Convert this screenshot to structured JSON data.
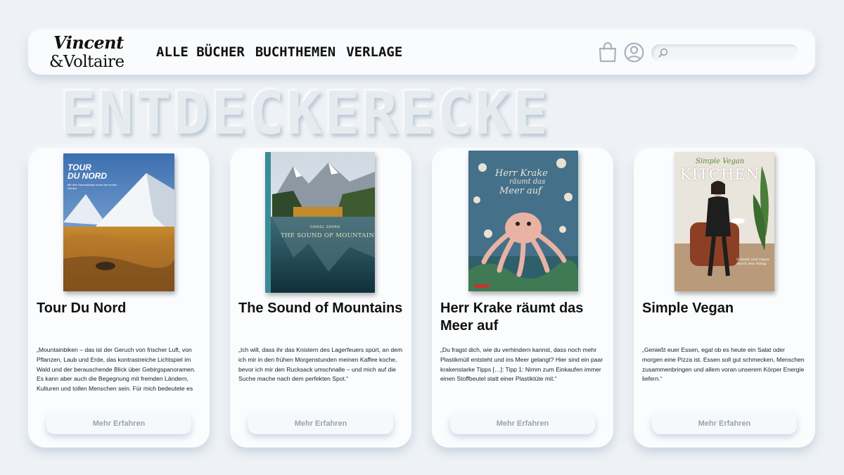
{
  "brand": {
    "line1": "Vincent",
    "line2": "&Voltaire"
  },
  "nav": {
    "items": [
      "ALLE BÜCHER",
      "BUCHTHEMEN",
      "VERLAGE"
    ]
  },
  "search": {
    "placeholder": ""
  },
  "hero": {
    "title": "ENTDECKERECKE"
  },
  "books": [
    {
      "title": "Tour Du Nord",
      "excerpt": "„Mountainbiken – das ist der Geruch von frischer Luft, von Pflanzen, Laub und Erde, das kontrastreiche Lichtspiel im Wald und der berauschende Blick über Gebirgspanoramen. Es kann aber auch die Begegnung mit fremden Ländern, Kulturen und tollen Menschen sein. Für mich bedeutete es allerdings lange",
      "button": "Mehr Erfahren",
      "cover": {
        "title_l1": "TOUR",
        "title_l2": "DU NORD",
        "subtitle": "Mit dem Mountainbike durch den hohen Norden"
      }
    },
    {
      "title": "The Sound of Mountains",
      "excerpt": "„Ich will, dass ihr das Knistern des Lagerfeuers spürt, an dem ich mir in den frühen Morgenstunden meinen Kaffee koche, bevor ich mir den Rucksack umschnalle – und mich auf die Suche mache nach dem perfekten Spot.“",
      "button": "Mehr Erfahren",
      "cover": {
        "author": "DANIEL SAHAN",
        "title": "THE SOUND OF MOUNTAINS"
      }
    },
    {
      "title": "Herr Krake räumt das Meer auf",
      "excerpt": "„Du fragst dich, wie du verhindern kannst, dass noch mehr Plastikmüll entsteht und ins Meer gelangt? Hier sind ein paar krakenstarke Tipps […]: Tipp 1: Nimm zum Einkaufen immer einen Stoffbeutel statt einer Plastiktüte mit.“",
      "button": "Mehr Erfahren",
      "cover": {
        "title_l1": "Herr Krake",
        "title_l2": "räumt das",
        "title_l3": "Meer auf"
      }
    },
    {
      "title": "Simple Vegan",
      "excerpt": "„Genießt euer Essen, egal ob es heute ein Salat oder morgen eine Pizza ist. Essen soll gut schmecken, Menschen zusammenbringen und allem voran unserem Körper Energie liefern.“",
      "button": "Mehr Erfahren",
      "cover": {
        "script": "Simple Vegan",
        "title": "KITCHEN",
        "tagline": "Schnell und vegan durch den Alltag"
      }
    }
  ],
  "colors": {
    "background": "#eef2f6",
    "card": "#fafcfe",
    "button_text": "#9aa4ad",
    "hero_text": "#e6ebf0"
  }
}
